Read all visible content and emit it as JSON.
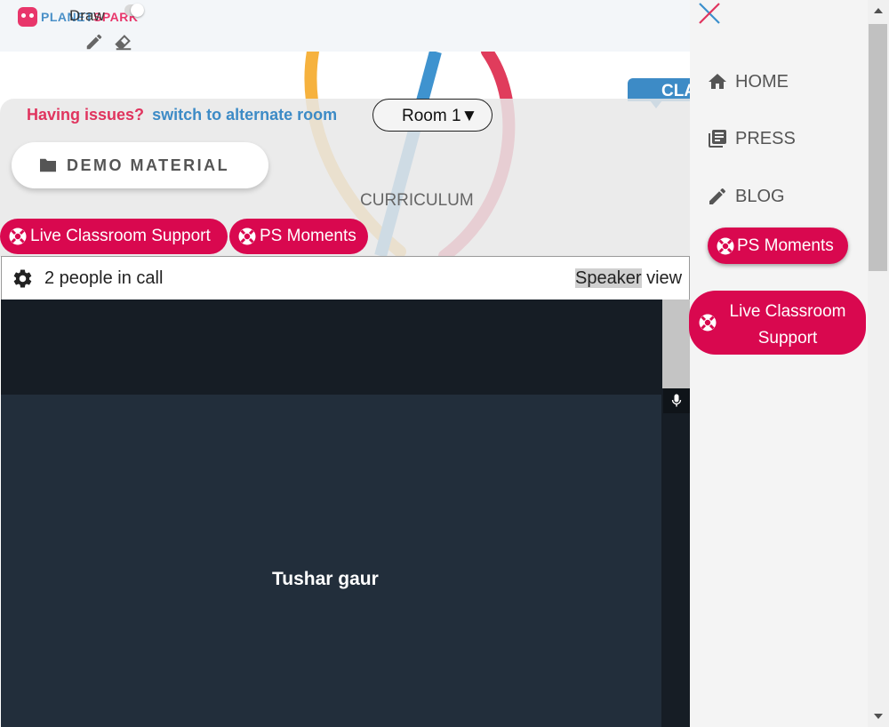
{
  "brand": {
    "logo_text_left": "PLANET",
    "logo_text_right": "SPARK"
  },
  "toolbar": {
    "draw_label": "Draw"
  },
  "classroom": {
    "tag_text": "CLA",
    "issues_prefix": "Having issues?",
    "issues_link": "switch to alternate room",
    "room_selected": "Room 1▼",
    "demo_material_label": "DEMO MATERIAL",
    "curriculum_label": "CURRICULUM"
  },
  "support_buttons": {
    "live_support_label": "Live Classroom Support",
    "ps_moments_label": "PS Moments"
  },
  "call": {
    "people_count_label": "2 people in call",
    "speaker_word": "Speaker",
    "view_word": "view",
    "participant_name": "Tushar gaur"
  },
  "drawer": {
    "nav": [
      {
        "label": "HOME",
        "icon": "home-icon"
      },
      {
        "label": "PRESS",
        "icon": "newspaper-icon"
      },
      {
        "label": "BLOG",
        "icon": "pencil-icon"
      }
    ],
    "ps_moments_label": "PS Moments",
    "live_support_line1": "Live Classroom",
    "live_support_line2": "Support"
  },
  "colors": {
    "accent_pink": "#d9084f",
    "link_blue": "#3d8bc6",
    "issue_red": "#e0345e",
    "video_bg": "#222e3b"
  }
}
